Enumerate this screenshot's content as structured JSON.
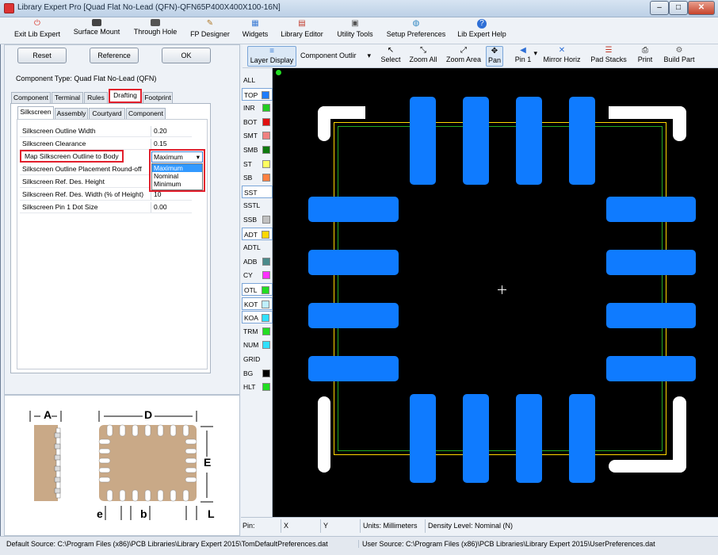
{
  "window": {
    "title": "Library Expert Pro [Quad Flat No-Lead (QFN)-QFN65P400X400X100-16N]",
    "min": "–",
    "max": "□",
    "close": "✕"
  },
  "menu": [
    {
      "label": "Exit Lib Expert",
      "icon": "exit-icon",
      "color": "#d9362b"
    },
    {
      "label": "Surface Mount",
      "icon": "smd-chip-icon",
      "color": "#444"
    },
    {
      "label": "Through Hole",
      "icon": "th-chip-icon",
      "color": "#444"
    },
    {
      "label": "FP Designer",
      "icon": "pencil-icon",
      "color": "#b07a2a"
    },
    {
      "label": "Widgets",
      "icon": "widgets-icon",
      "color": "#3a7bd5"
    },
    {
      "label": "Library Editor",
      "icon": "books-icon",
      "color": "#c0392b"
    },
    {
      "label": "Utility Tools",
      "icon": "calculator-icon",
      "color": "#555"
    },
    {
      "label": "Setup Preferences",
      "icon": "globe-icon",
      "color": "#2e86c1"
    },
    {
      "label": "Lib Expert Help",
      "icon": "help-icon",
      "color": "#2e6fd6"
    }
  ],
  "left": {
    "reset": "Reset",
    "reference": "Reference",
    "ok": "OK",
    "component_type": "Component Type: Quad Flat No-Lead (QFN)",
    "tabs": [
      "Component",
      "Terminal",
      "Rules",
      "Drafting",
      "Footprint"
    ],
    "subtabs": [
      "Silkscreen",
      "Assembly",
      "Courtyard",
      "Component"
    ],
    "rows": [
      {
        "label": "Silkscreen Outline Width",
        "value": "0.20"
      },
      {
        "label": "Silkscreen Clearance",
        "value": "0.15"
      },
      {
        "label": "Map Silkscreen Outline to Body",
        "value": "Maximum"
      },
      {
        "label": "Silkscreen Outline Placement Round-off",
        "value": ""
      },
      {
        "label": "Silkscreen Ref. Des. Height",
        "value": ""
      },
      {
        "label": "Silkscreen Ref. Des. Width (% of Height)",
        "value": "10"
      },
      {
        "label": "Silkscreen Pin 1 Dot Size",
        "value": "0.00"
      }
    ],
    "dropdown_options": [
      "Maximum",
      "Nominal",
      "Minimum"
    ]
  },
  "illustration": {
    "a": "A",
    "d": "D",
    "e_height": "E",
    "e_pitch": "e",
    "b": "b",
    "l": "L"
  },
  "toolbar": [
    {
      "label": "Layer Display",
      "icon": "layers-icon"
    },
    {
      "label": "Component Outlir",
      "icon": "dropdown"
    },
    {
      "label": "Select",
      "icon": "cursor-icon"
    },
    {
      "label": "Zoom All",
      "icon": "zoom-all-icon"
    },
    {
      "label": "Zoom Area",
      "icon": "zoom-area-icon"
    },
    {
      "label": "Pan",
      "icon": "pan-icon"
    },
    {
      "label": "Pin 1",
      "icon": "pin1-icon"
    },
    {
      "label": "Mirror Horiz",
      "icon": "mirror-icon"
    },
    {
      "label": "Pad Stacks",
      "icon": "padstacks-icon"
    },
    {
      "label": "Print",
      "icon": "printer-icon"
    },
    {
      "label": "Build Part",
      "icon": "build-icon"
    }
  ],
  "layers": [
    {
      "name": "ALL",
      "color": ""
    },
    {
      "name": "TOP",
      "color": "#1e7cff"
    },
    {
      "name": "INR",
      "color": "#22cc22"
    },
    {
      "name": "BOT",
      "color": "#e01010"
    },
    {
      "name": "SMT",
      "color": "#f08080"
    },
    {
      "name": "SMB",
      "color": "#0e7a0e"
    },
    {
      "name": "ST",
      "color": "#ffff60"
    },
    {
      "name": "SB",
      "color": "#ff8040"
    },
    {
      "name": "SST",
      "color": ""
    },
    {
      "name": "SSTL",
      "color": ""
    },
    {
      "name": "SSB",
      "color": "#c0c0c0"
    },
    {
      "name": "ADT",
      "color": "#ffd700"
    },
    {
      "name": "ADTL",
      "color": ""
    },
    {
      "name": "ADB",
      "color": "#4a8a8a"
    },
    {
      "name": "CY",
      "color": "#ff30ff"
    },
    {
      "name": "OTL",
      "color": "#22dd22"
    },
    {
      "name": "KOT",
      "color": "#bfefff"
    },
    {
      "name": "KOA",
      "color": "#30e0ff"
    },
    {
      "name": "TRM",
      "color": "#22dd22"
    },
    {
      "name": "NUM",
      "color": "#30e0ff"
    },
    {
      "name": "GRID",
      "color": ""
    },
    {
      "name": "BG",
      "color": "#000000"
    },
    {
      "name": "HLT",
      "color": "#22dd22"
    }
  ],
  "status": {
    "pin": "Pin:",
    "x": "X",
    "y": "Y",
    "units": "Units: Millimeters",
    "density": "Density Level: Nominal (N)"
  },
  "sources": {
    "default": "Default Source:   C:\\Program Files (x86)\\PCB Libraries\\Library Expert 2015\\TomDefaultPreferences.dat",
    "user": "User Source:   C:\\Program Files (x86)\\PCB Libraries\\Library Expert 2015\\UserPreferences.dat"
  }
}
